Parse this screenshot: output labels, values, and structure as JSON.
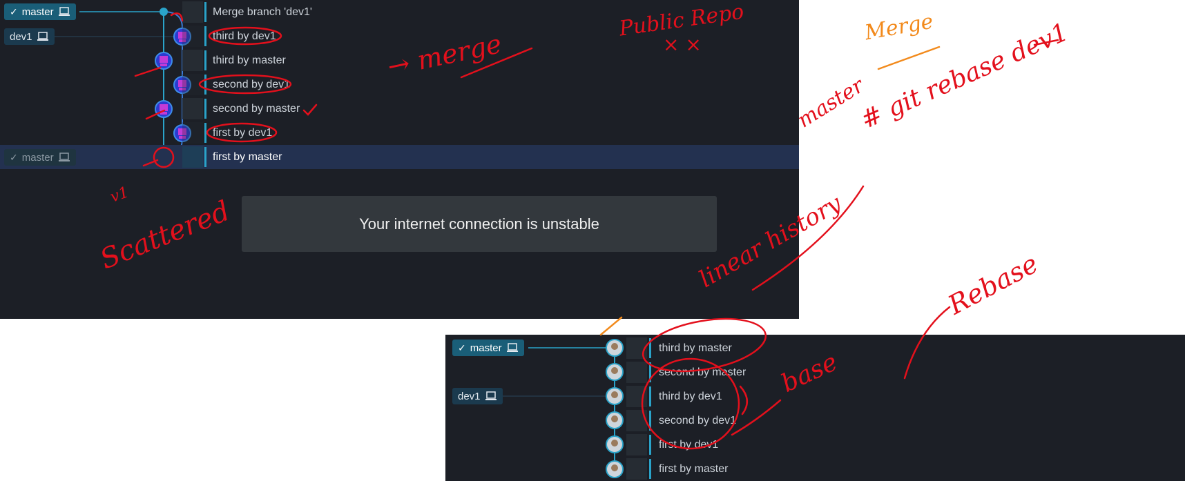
{
  "top_panel": {
    "branches": {
      "master_label": "master",
      "dev1_label": "dev1",
      "master_old_label": "master"
    },
    "commits": [
      {
        "message": "Merge branch 'dev1'"
      },
      {
        "message": "third by dev1"
      },
      {
        "message": "third by master"
      },
      {
        "message": "second by dev1"
      },
      {
        "message": "second by master"
      },
      {
        "message": "first by dev1"
      },
      {
        "message": "first by master"
      }
    ],
    "toast": "Your internet connection is unstable"
  },
  "bottom_panel": {
    "branches": {
      "master_label": "master",
      "dev1_label": "dev1"
    },
    "commits": [
      {
        "message": "third by master"
      },
      {
        "message": "second by master"
      },
      {
        "message": "third by dev1"
      },
      {
        "message": "second by dev1"
      },
      {
        "message": "first by dev1"
      },
      {
        "message": "first by master"
      }
    ]
  },
  "annotations": {
    "merge_arrow": "→ merge",
    "public_repo": "Public Repo",
    "public_repo_marks": "× ×",
    "merge_orange": "Merge",
    "master_note": "master",
    "git_rebase": "# git rebase dev1",
    "scattered": "Scattered",
    "v1": "v1",
    "linear_history": "linear history",
    "rebase": "Rebase",
    "base": "base"
  },
  "colors": {
    "panel_bg": "#1c1f26",
    "accent": "#2aa3c9",
    "selected_row": "#233150",
    "annotation_red": "#e3101c",
    "annotation_orange": "#f28a1c"
  }
}
